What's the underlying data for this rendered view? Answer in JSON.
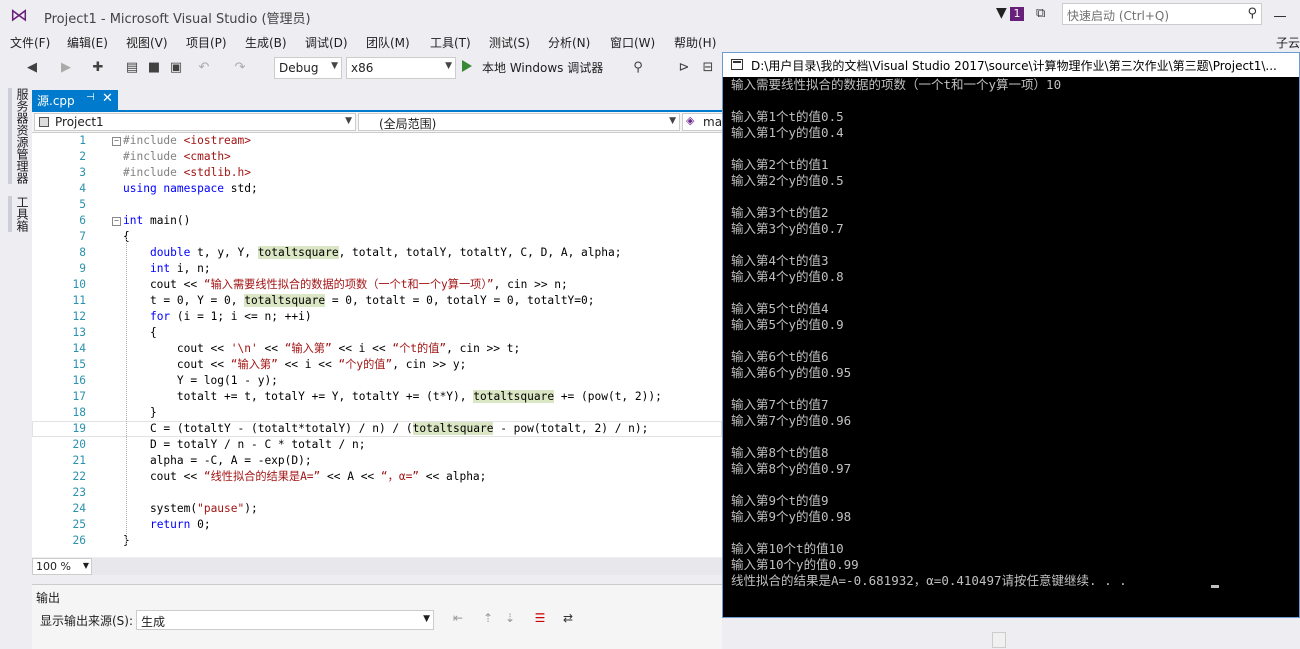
{
  "window": {
    "title": "Project1 - Microsoft Visual Studio (管理员)",
    "notification_count": "1",
    "quick_launch_placeholder": "快速启动 (Ctrl+Q)",
    "user_name": "子云"
  },
  "menu": [
    "文件(F)",
    "编辑(E)",
    "视图(V)",
    "项目(P)",
    "生成(B)",
    "调试(D)",
    "团队(M)",
    "工具(T)",
    "测试(S)",
    "分析(N)",
    "窗口(W)",
    "帮助(H)"
  ],
  "toolbar": {
    "config": "Debug",
    "platform": "x86",
    "run_label": "本地 Windows 调试器"
  },
  "side_tabs": [
    "服务器资源管理器",
    "工具箱"
  ],
  "editor": {
    "tab_label": "源.cpp",
    "nav_project": "Project1",
    "nav_scope": "(全局范围)",
    "nav_member": "ma",
    "zoom": "100 %",
    "lines": [
      {
        "n": "1",
        "html": "<span class=\"pp\">#include</span> <span class=\"str\">&lt;iostream&gt;</span>"
      },
      {
        "n": "2",
        "html": "<span class=\"pp\">#include</span> <span class=\"str\">&lt;cmath&gt;</span>"
      },
      {
        "n": "3",
        "html": "<span class=\"pp\">#include</span> <span class=\"str\">&lt;stdlib.h&gt;</span>"
      },
      {
        "n": "4",
        "html": "<span class=\"kw\">using namespace</span> std;"
      },
      {
        "n": "5",
        "html": ""
      },
      {
        "n": "6",
        "html": "<span class=\"kw\">int</span> main()"
      },
      {
        "n": "7",
        "html": "{"
      },
      {
        "n": "8",
        "html": "    <span class=\"kw\">double</span> t, y, Y, <span class=\"hl\">totaltsquare</span>, totalt, totalY, totaltY, C, D, A, alpha;"
      },
      {
        "n": "9",
        "html": "    <span class=\"kw\">int</span> i, n;"
      },
      {
        "n": "10",
        "html": "    cout &lt;&lt; <span class=\"str\">“输入需要线性拟合的数据的项数（一个t和一个y算一项）”</span>, cin &gt;&gt; n;"
      },
      {
        "n": "11",
        "html": "    t = 0, Y = 0, <span class=\"hl\">totaltsquare</span> = 0, totalt = 0, totalY = 0, totaltY=0;"
      },
      {
        "n": "12",
        "html": "    <span class=\"kw\">for</span> (i = 1; i &lt;= n; ++i)"
      },
      {
        "n": "13",
        "html": "    {"
      },
      {
        "n": "14",
        "html": "        cout &lt;&lt; <span class=\"str\">'\\n'</span> &lt;&lt; <span class=\"str\">“输入第”</span> &lt;&lt; i &lt;&lt; <span class=\"str\">“个t的值”</span>, cin &gt;&gt; t;"
      },
      {
        "n": "15",
        "html": "        cout &lt;&lt; <span class=\"str\">“输入第”</span> &lt;&lt; i &lt;&lt; <span class=\"str\">“个y的值”</span>, cin &gt;&gt; y;"
      },
      {
        "n": "16",
        "html": "        Y = log(1 - y);"
      },
      {
        "n": "17",
        "html": "        totalt += t, totalY += Y, totaltY += (t*Y), <span class=\"hl\">totaltsquare</span> += (pow(t, 2));"
      },
      {
        "n": "18",
        "html": "    }"
      },
      {
        "n": "19",
        "html": "    C = (totaltY - (totalt*totalY) / n) / (<span class=\"hl\">totaltsquare</span> - pow(totalt, 2) / n);"
      },
      {
        "n": "20",
        "html": "    D = totalY / n - C * totalt / n;"
      },
      {
        "n": "21",
        "html": "    alpha = -C, A = -exp(D);"
      },
      {
        "n": "22",
        "html": "    cout &lt;&lt; <span class=\"str\">“线性拟合的结果是A=”</span> &lt;&lt; A &lt;&lt; <span class=\"str\">“，α=”</span> &lt;&lt; alpha;"
      },
      {
        "n": "23",
        "html": ""
      },
      {
        "n": "24",
        "html": "    system(<span class=\"str\">\"pause\"</span>);"
      },
      {
        "n": "25",
        "html": "    <span class=\"kw\">return</span> 0;"
      },
      {
        "n": "26",
        "html": "}"
      }
    ]
  },
  "output": {
    "title": "输出",
    "source_label": "显示输出来源(S):",
    "source_value": "生成"
  },
  "console": {
    "title": "D:\\用户目录\\我的文档\\Visual Studio 2017\\source\\计算物理作业\\第三次作业\\第三题\\Project1\\...",
    "lines": [
      "输入需要线性拟合的数据的项数（一个t和一个y算一项）10",
      "",
      "输入第1个t的值0.5",
      "输入第1个y的值0.4",
      "",
      "输入第2个t的值1",
      "输入第2个y的值0.5",
      "",
      "输入第3个t的值2",
      "输入第3个y的值0.7",
      "",
      "输入第4个t的值3",
      "输入第4个y的值0.8",
      "",
      "输入第5个t的值4",
      "输入第5个y的值0.9",
      "",
      "输入第6个t的值6",
      "输入第6个y的值0.95",
      "",
      "输入第7个t的值7",
      "输入第7个y的值0.96",
      "",
      "输入第8个t的值8",
      "输入第8个y的值0.97",
      "",
      "输入第9个t的值9",
      "输入第9个y的值0.98",
      "",
      "输入第10个t的值10",
      "输入第10个y的值0.99",
      "线性拟合的结果是A=-0.681932，α=0.410497请按任意键继续. . ."
    ]
  }
}
